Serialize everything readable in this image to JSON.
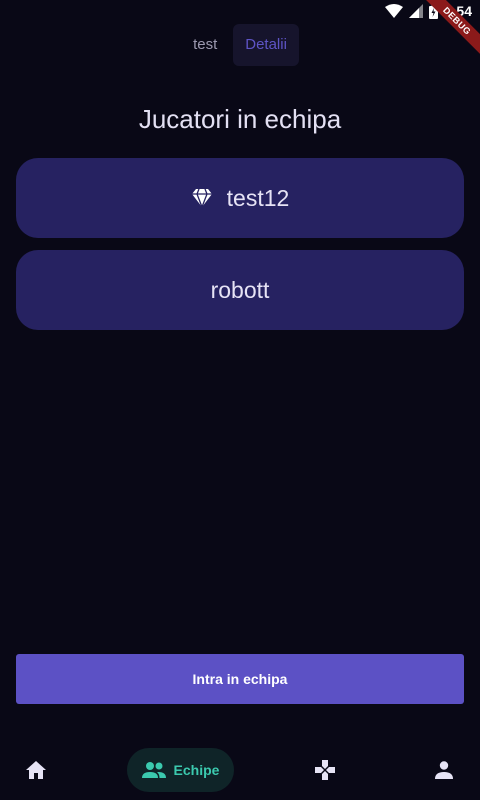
{
  "status_bar": {
    "time": "9:54",
    "debug_label": "DEBUG"
  },
  "tabs": [
    {
      "label": "test",
      "active": false
    },
    {
      "label": "Detalii",
      "active": true
    }
  ],
  "page_title": "Jucatori in echipa",
  "players": [
    {
      "name": "test12",
      "icon": "gem-icon"
    },
    {
      "name": "robott"
    }
  ],
  "join_button_label": "Intra in echipa",
  "bottom_nav": {
    "items": [
      {
        "icon": "home-icon",
        "label": ""
      },
      {
        "icon": "people-icon",
        "label": "Echipe",
        "active": true
      },
      {
        "icon": "gamepad-icon",
        "label": ""
      },
      {
        "icon": "person-icon",
        "label": ""
      }
    ]
  },
  "colors": {
    "background": "#090816",
    "card": "#262261",
    "accent": "#5c51c5",
    "nav_active": "#3bc9ae"
  }
}
